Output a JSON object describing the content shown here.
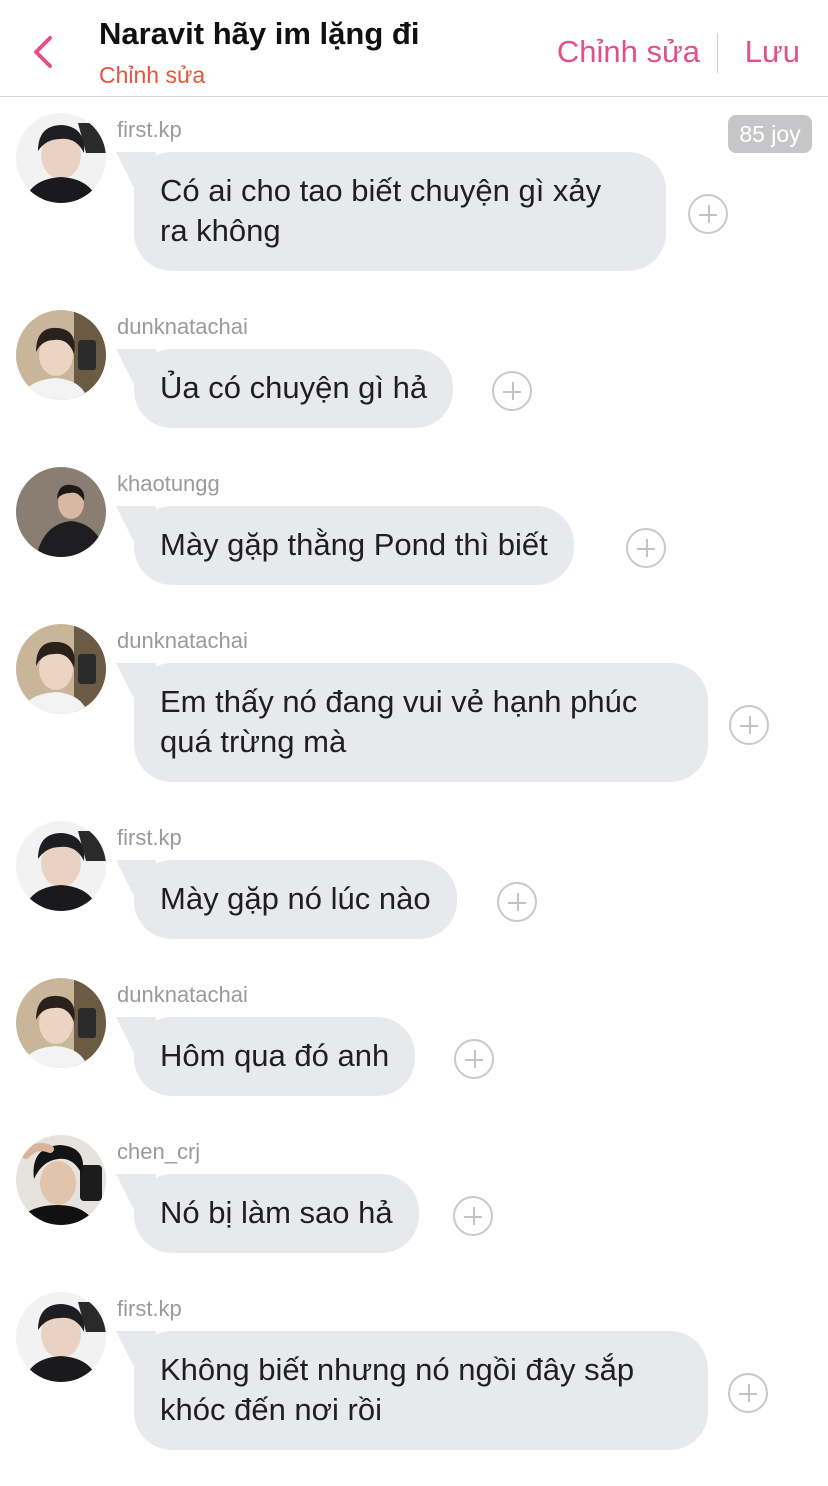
{
  "header": {
    "title": "Naravit hãy im lặng đi",
    "subtitle": "Chỉnh sửa",
    "edit_label": "Chỉnh sửa",
    "save_label": "Lưu",
    "accent_color": "#e2508a",
    "subtitle_color": "#e8533a"
  },
  "badge": {
    "label": "85 joy"
  },
  "messages": [
    {
      "username": "first.kp",
      "text_lines": [
        "Có ai cho tao biết chuyện gì xảy",
        "ra không"
      ],
      "avatar": "avatar-first"
    },
    {
      "username": "dunknatachai",
      "text_lines": [
        "Ủa có chuyện gì hả"
      ],
      "avatar": "avatar-dunk"
    },
    {
      "username": "khaotungg",
      "text_lines": [
        "Mày gặp thằng Pond thì biết"
      ],
      "avatar": "avatar-khao"
    },
    {
      "username": "dunknatachai",
      "text_lines": [
        "Em thấy nó đang vui vẻ hạnh phúc",
        "quá trừng mà"
      ],
      "avatar": "avatar-dunk"
    },
    {
      "username": "first.kp",
      "text_lines": [
        "Mày gặp nó lúc nào"
      ],
      "avatar": "avatar-first"
    },
    {
      "username": "dunknatachai",
      "text_lines": [
        "Hôm qua đó anh"
      ],
      "avatar": "avatar-dunk"
    },
    {
      "username": "chen_crj",
      "text_lines": [
        "Nó bị làm sao hả"
      ],
      "avatar": "avatar-chen"
    },
    {
      "username": "first.kp",
      "text_lines": [
        "Không biết nhưng nó ngồi đây sắp",
        "khóc đến nơi rồi"
      ],
      "avatar": "avatar-first"
    }
  ]
}
